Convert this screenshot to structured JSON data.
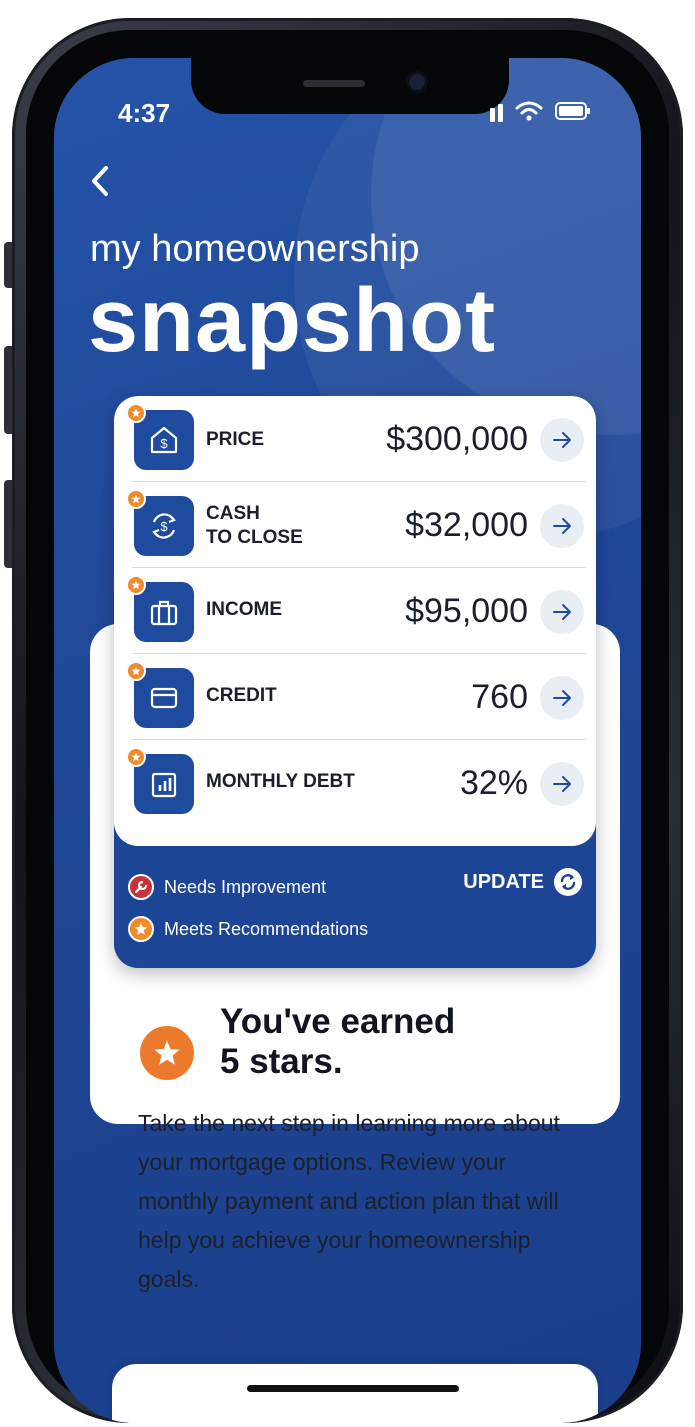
{
  "status_bar": {
    "time": "4:37"
  },
  "header": {
    "back_icon": "chevron-left-icon",
    "subtitle": "my homeownership",
    "title": "snapshot"
  },
  "items": [
    {
      "label": "PRICE",
      "value": "$300,000",
      "icon": "house-dollar-icon"
    },
    {
      "label": "CASH TO CLOSE",
      "label_line1": "CASH",
      "label_line2": "TO CLOSE",
      "value": "$32,000",
      "icon": "cash-exchange-icon"
    },
    {
      "label": "INCOME",
      "value": "$95,000",
      "icon": "briefcase-icon"
    },
    {
      "label": "CREDIT",
      "value": "760",
      "icon": "credit-card-icon"
    },
    {
      "label": "MONTHLY DEBT",
      "value": "32%",
      "icon": "bar-chart-icon"
    }
  ],
  "legend": {
    "needs_improvement": "Needs Improvement",
    "meets_recommendations": "Meets Recommendations"
  },
  "update_label": "UPDATE",
  "earned": {
    "line1": "You've earned",
    "line2": "5 stars."
  },
  "description": "Take the next step in learning more about your mortgage options. Review your monthly payment and action plan that will help you achieve your homeownership goals.",
  "colors": {
    "primary": "#1d4596",
    "star_orange": "#f08a2b",
    "needs_red": "#c8323a"
  }
}
